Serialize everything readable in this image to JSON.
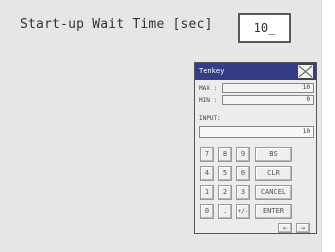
{
  "setting": {
    "label": "Start-up Wait Time [sec]",
    "value": "10_"
  },
  "tenkey": {
    "title": "Tenkey",
    "max_label": "MAX :",
    "max_value": "10",
    "min_label": "MIN :",
    "min_value": "0",
    "input_label": "INPUT:",
    "input_value": "10",
    "keys": {
      "seven": "7",
      "eight": "8",
      "nine": "9",
      "bs": "BS",
      "four": "4",
      "five": "5",
      "six": "6",
      "clr": "CLR",
      "one": "1",
      "two": "2",
      "three": "3",
      "cancel": "CANCEL",
      "zero": "0",
      "dot": ".",
      "sign": "+/-",
      "enter": "ENTER",
      "left": "←",
      "right": "→"
    }
  },
  "colors": {
    "title_bar": "#363c88",
    "panel_bg": "#e6e6e6"
  }
}
